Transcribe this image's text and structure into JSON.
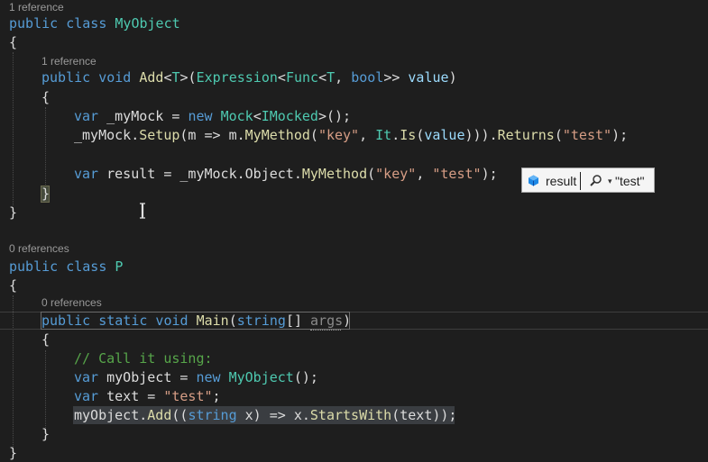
{
  "codelens": {
    "class1": "1 reference",
    "add_method": "1 reference",
    "class2": "0 references",
    "main_method": "0 references"
  },
  "code": {
    "l1_kw": "public class ",
    "l1_name": "MyObject",
    "open_brace": "{",
    "close_brace": "}",
    "l3_kw": "public void ",
    "l3_name": "Add",
    "l3_lt": "<",
    "l3_t": "T",
    "l3_gt": ">(",
    "l3_expr": "Expression",
    "l3_lt2": "<",
    "l3_func": "Func",
    "l3_lt3": "<",
    "l3_t2": "T",
    "l3_comma": ", ",
    "l3_bool": "bool",
    "l3_close": ">> ",
    "l3_param": "value",
    "l3_paren": ")",
    "l5_kw": "var ",
    "l5_text": "_myMock = ",
    "l5_new": "new ",
    "l5_mock": "Mock",
    "l5_lt": "<",
    "l5_imocked": "IMocked",
    "l5_end": ">();",
    "l6_a": "_myMock.",
    "l6_setup": "Setup",
    "l6_b": "(m => m.",
    "l6_mymethod": "MyMethod",
    "l6_c": "(",
    "l6_key": "\"key\"",
    "l6_d": ", ",
    "l6_it": "It",
    "l6_e": ".",
    "l6_is": "Is",
    "l6_f": "(",
    "l6_value": "value",
    "l6_g": "))).",
    "l6_returns": "Returns",
    "l6_h": "(",
    "l6_test": "\"test\"",
    "l6_i": ");",
    "l8_kw": "var ",
    "l8_a": "result = _myMock.Object.",
    "l8_mymethod": "MyMethod",
    "l8_b": "(",
    "l8_key": "\"key\"",
    "l8_c": ", ",
    "l8_test": "\"test\"",
    "l8_d": ");",
    "p_kw": "public class ",
    "p_name": "P",
    "main_kw": "public static void ",
    "main_name": "Main",
    "main_a": "(",
    "main_string": "string",
    "main_b": "[] ",
    "main_args": "args",
    "main_c": ")",
    "comment": "// Call it using:",
    "m1_kw": "var ",
    "m1_a": "myObject = ",
    "m1_new": "new ",
    "m1_type": "MyObject",
    "m1_b": "();",
    "m2_kw": "var ",
    "m2_a": "text = ",
    "m2_str": "\"test\"",
    "m2_b": ";",
    "m3_a": "myObject.",
    "m3_add": "Add",
    "m3_b": "((",
    "m3_string": "string",
    "m3_c": " x) => x.",
    "m3_sw": "StartsWith",
    "m3_d": "(text));"
  },
  "datatip": {
    "name": "result",
    "value": "\"test\"",
    "icon": "local-variable-icon",
    "search_icon": "magnifier-icon"
  },
  "colors": {
    "background": "#1e1e1e",
    "keyword": "#569cd6",
    "type": "#4ec9b0",
    "method": "#dcdcaa",
    "string": "#d69d85",
    "comment": "#57a64a",
    "parameter": "#9cdcfe"
  }
}
